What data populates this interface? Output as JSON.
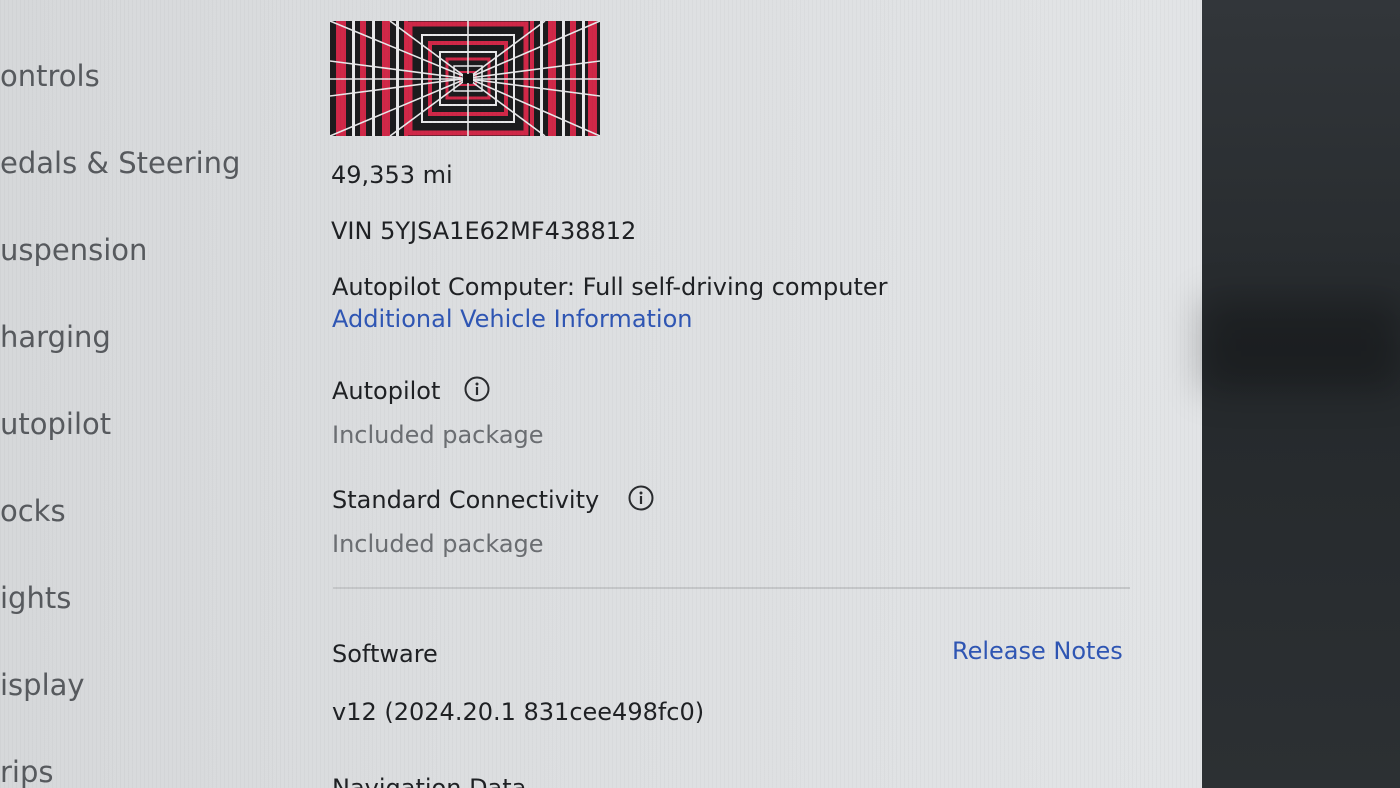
{
  "sidebar": {
    "items": [
      {
        "label": "ontrols"
      },
      {
        "label": "edals & Steering"
      },
      {
        "label": "uspension"
      },
      {
        "label": "harging"
      },
      {
        "label": "utopilot"
      },
      {
        "label": "ocks"
      },
      {
        "label": "ights"
      },
      {
        "label": "isplay"
      },
      {
        "label": "rips"
      }
    ]
  },
  "vehicle": {
    "odometer": "49,353  mi",
    "vin": "VIN 5YJSA1E62MF438812",
    "autopilot_computer": "Autopilot Computer: Full self-driving computer",
    "additional_info_link": "Additional Vehicle Information"
  },
  "packages": [
    {
      "name": "Autopilot",
      "status": "Included package",
      "icon": "info-icon"
    },
    {
      "name": "Standard Connectivity",
      "status": "Included package",
      "icon": "info-icon"
    }
  ],
  "software": {
    "label": "Software",
    "release_notes_link": "Release Notes",
    "version": "v12 (2024.20.1 831cee498fc0)"
  },
  "next_section_label": "Navigation Data",
  "colors": {
    "screen_bg": "#dcdee0",
    "text": "#1f2124",
    "muted_text": "#6b6e72",
    "link": "#2f56b4",
    "image_red": "#d02848",
    "bezel": "#2a2d2f"
  }
}
